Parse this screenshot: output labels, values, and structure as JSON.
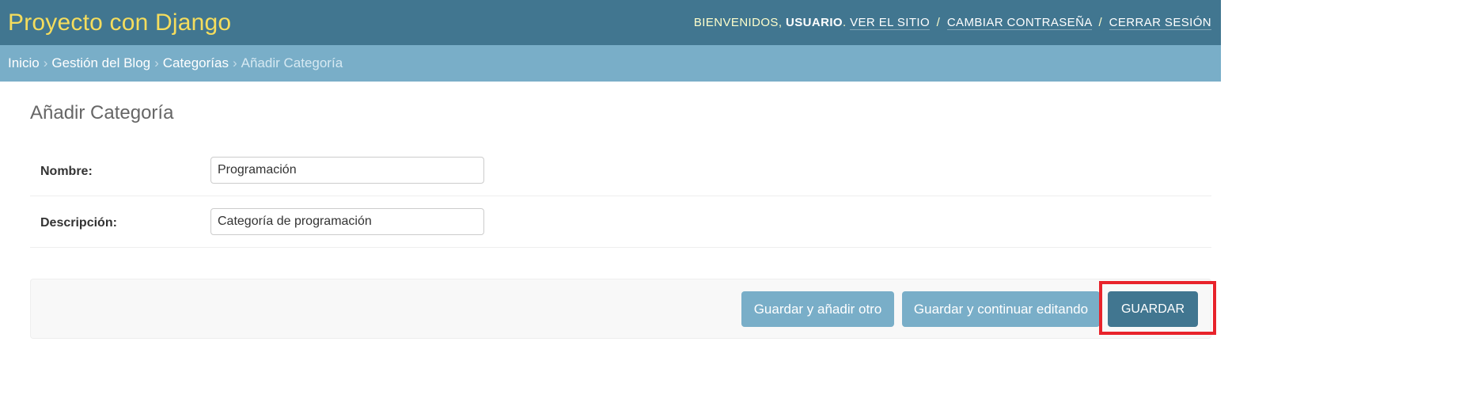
{
  "header": {
    "brand": "Proyecto con Django",
    "welcome": "Bienvenidos,",
    "username": "Usuario",
    "links": {
      "view_site": "Ver el sitio",
      "change_password": "Cambiar contraseña",
      "logout": "Cerrar sesión"
    },
    "separator": "/"
  },
  "breadcrumbs": {
    "items": [
      "Inicio",
      "Gestión del Blog",
      "Categorías"
    ],
    "current": "Añadir Categoría",
    "arrow": "›"
  },
  "page": {
    "title": "Añadir Categoría"
  },
  "form": {
    "nombre": {
      "label": "Nombre:",
      "value": "Programación"
    },
    "descripcion": {
      "label": "Descripción:",
      "value": "Categoría de programación"
    }
  },
  "actions": {
    "save_add_another": "Guardar y añadir otro",
    "save_continue": "Guardar y continuar editando",
    "save": "Guardar"
  },
  "colors": {
    "header_bg": "#417690",
    "breadcrumb_bg": "#79aec8",
    "brand_text": "#f5dd5d",
    "highlight": "#e8232b"
  }
}
